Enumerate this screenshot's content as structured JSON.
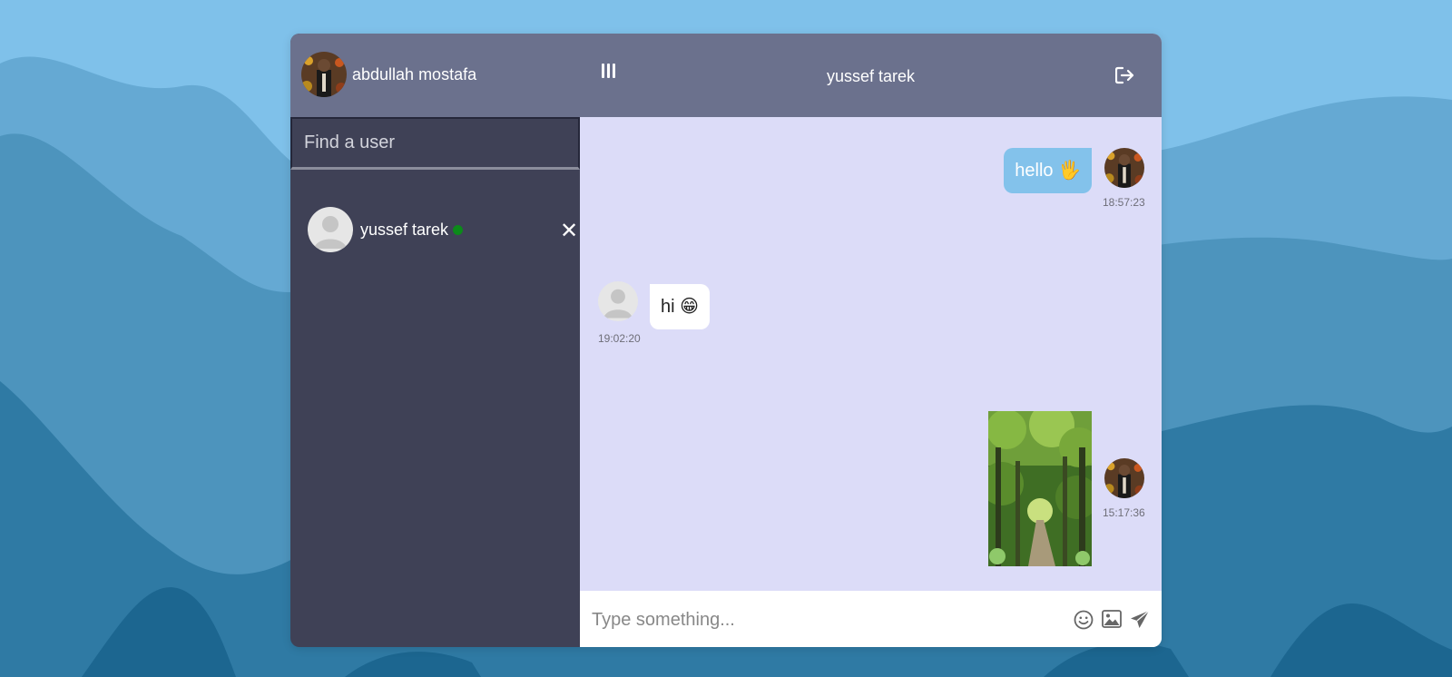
{
  "current_user": {
    "name": "abdullah mostafa"
  },
  "search": {
    "placeholder": "Find a user"
  },
  "contacts": [
    {
      "name": "yussef tarek",
      "status": "online",
      "remove_label": "✕"
    }
  ],
  "chat": {
    "title": "yussef tarek"
  },
  "messages": [
    {
      "direction": "outgoing",
      "text": "hello 🖐",
      "time": "18:57:23"
    },
    {
      "direction": "incoming",
      "text": "hi 😁",
      "time": "19:02:20"
    },
    {
      "direction": "outgoing",
      "type": "image",
      "time": "15:17:36"
    }
  ],
  "composer": {
    "placeholder": "Type something..."
  },
  "icons": {
    "menu": "menu-bars-icon",
    "logout": "logout-icon",
    "emoji": "smiley-icon",
    "image": "image-icon",
    "send": "send-icon",
    "close": "close-icon"
  },
  "colors": {
    "header": "#6b718d",
    "sidebar": "#3f4156",
    "chat_background": "#dcdcf8",
    "outgoing_bubble": "#83c2eb",
    "incoming_bubble": "#ffffff",
    "online": "#0c8a1a",
    "page_background": "#7fc1ea"
  }
}
